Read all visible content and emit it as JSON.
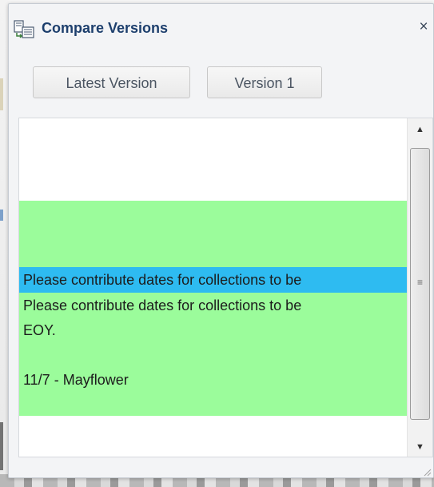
{
  "dialog": {
    "title": "Compare Versions",
    "close_label": "×",
    "icon": "compare-versions-icon"
  },
  "toolbar": {
    "buttons": [
      {
        "label": "Latest Version"
      },
      {
        "label": "Version 1"
      }
    ]
  },
  "content": {
    "lines": [
      "Please contribute dates for collections to be",
      "Please contribute dates for collections to be",
      "EOY.",
      "11/7 - Mayflower"
    ],
    "selected_line_index": 0
  },
  "scrollbar": {
    "up_arrow": "▲",
    "down_arrow": "▼",
    "grip": "≡"
  },
  "colors": {
    "added_highlight": "#9bfc9b",
    "selection_highlight": "#2ebbf1",
    "title_color": "#1d3f6d"
  }
}
